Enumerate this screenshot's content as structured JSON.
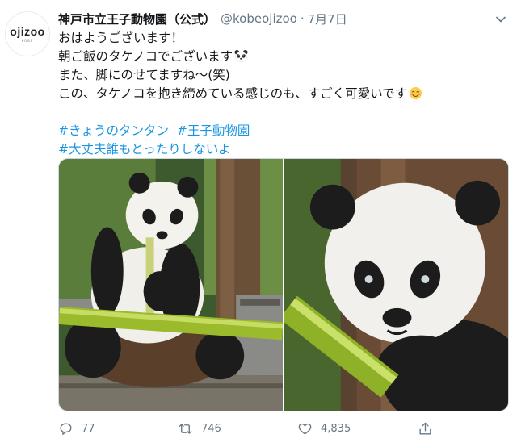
{
  "account": {
    "avatar_text": "ojizoo",
    "avatar_sub": "KOBE",
    "name": "神戸市立王子動物園（公式）",
    "handle": "@kobeojizoo",
    "separator": "·",
    "date": "7月7日"
  },
  "tweet": {
    "lines": [
      "おはようございます！",
      "朝ご飯のタケノコでございます",
      "また、脚にのせてますね～(笑)",
      "この、タケノコを抱き締めている感じのも、すごく可愛いです"
    ],
    "hashtags_line1": [
      "#きょうのタンタン",
      "#王子動物園"
    ],
    "hashtags_line2": [
      "#大丈夫誰もとったりしないよ"
    ],
    "emojis": [
      "panda-face",
      "smiling-face-with-blush"
    ]
  },
  "media": {
    "photos": [
      "panda-eating-bamboo-full",
      "panda-eating-bamboo-closeup"
    ]
  },
  "actions": {
    "reply_count": "77",
    "retweet_count": "746",
    "like_count": "4,835"
  },
  "colors": {
    "text": "#14171a",
    "secondary": "#657786",
    "link": "#1b95e0"
  }
}
